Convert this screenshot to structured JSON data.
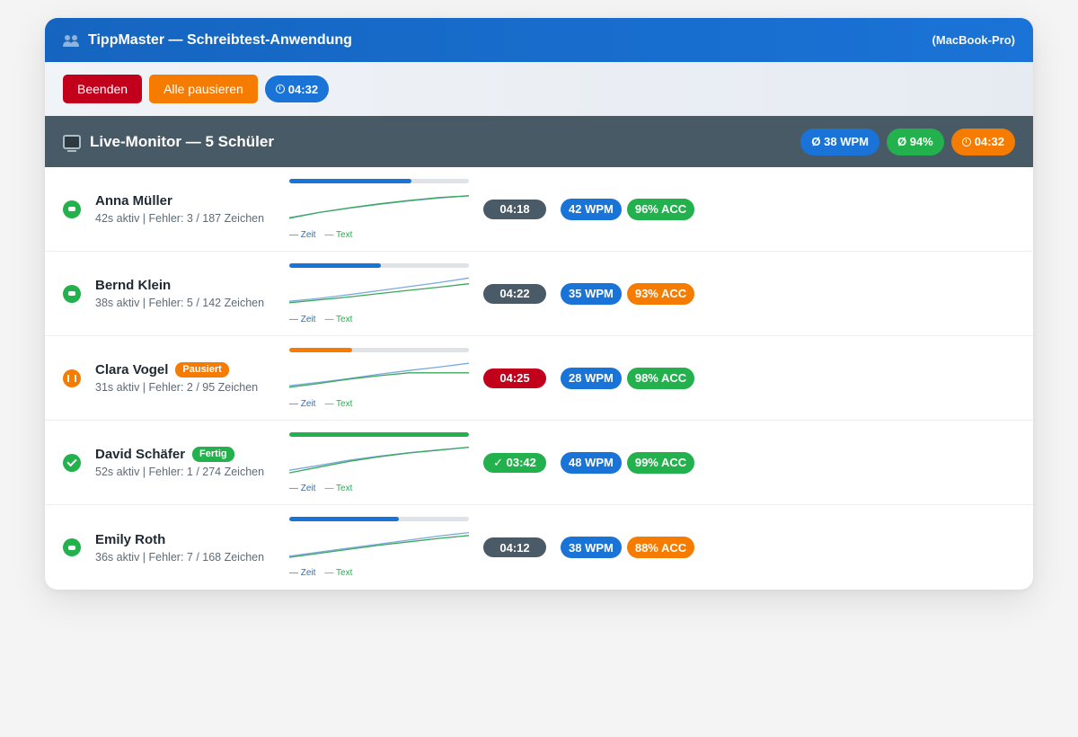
{
  "window": {
    "title": "TippMaster — Schreibtest-Anwendung",
    "device": "(MacBook-Pro)",
    "title_icon": "users-icon"
  },
  "toolbar": {
    "end_label": "Beenden",
    "pause_all_label": "Alle pausieren",
    "timer": "04:32"
  },
  "monitor": {
    "title": "Live-Monitor — 5 Schüler",
    "icon": "tv-icon",
    "avg_wpm": "Ø 38 WPM",
    "avg_acc": "Ø 94%",
    "timer": "04:32"
  },
  "legend": {
    "zeit": "— Zeit",
    "text": "— Text"
  },
  "colors": {
    "primary": "#1a73d6",
    "success": "#22b14c",
    "warning": "#f57c00",
    "danger": "#c2001b",
    "dark": "#4a5a66"
  },
  "students": [
    {
      "name": "Anna Müller",
      "badge": "",
      "status": "active",
      "meta": "42s aktiv | Fehler: 3 / 187 Zeichen",
      "progress": 0.68,
      "progress_color": "#1a73d6",
      "time": "04:18",
      "time_color": "dark",
      "wpm": "42 WPM",
      "acc": "96% ACC",
      "acc_color": "green",
      "zeit_series": [
        0.12,
        0.3,
        0.45,
        0.58,
        0.7,
        0.8,
        0.88
      ],
      "text_series": [
        0.1,
        0.3,
        0.46,
        0.6,
        0.72,
        0.82,
        0.88
      ]
    },
    {
      "name": "Bernd Klein",
      "badge": "",
      "status": "active",
      "meta": "38s aktiv | Fehler: 5 / 142 Zeichen",
      "progress": 0.51,
      "progress_color": "#1a73d6",
      "time": "04:22",
      "time_color": "dark",
      "wpm": "35 WPM",
      "acc": "93% ACC",
      "acc_color": "orange",
      "zeit_series": [
        0.15,
        0.25,
        0.38,
        0.52,
        0.66,
        0.8,
        0.96
      ],
      "text_series": [
        0.1,
        0.2,
        0.3,
        0.42,
        0.53,
        0.64,
        0.76
      ]
    },
    {
      "name": "Clara Vogel",
      "badge": "Pausiert",
      "status": "paused",
      "meta": "31s aktiv | Fehler: 2 / 95 Zeichen",
      "progress": 0.35,
      "progress_color": "#f57c00",
      "time": "04:25",
      "time_color": "red",
      "wpm": "28 WPM",
      "acc": "98% ACC",
      "acc_color": "green",
      "zeit_series": [
        0.15,
        0.27,
        0.4,
        0.55,
        0.68,
        0.8,
        0.93
      ],
      "text_series": [
        0.1,
        0.23,
        0.38,
        0.5,
        0.6,
        0.6,
        0.6
      ]
    },
    {
      "name": "David Schäfer",
      "badge": "Fertig",
      "status": "done",
      "meta": "52s aktiv | Fehler: 1 / 274 Zeichen",
      "progress": 1.0,
      "progress_color": "#22b14c",
      "time": "✓ 03:42",
      "time_color": "green",
      "wpm": "48 WPM",
      "acc": "99% ACC",
      "acc_color": "green",
      "zeit_series": [
        0.15,
        0.32,
        0.5,
        0.64,
        0.76,
        0.86,
        0.95
      ],
      "text_series": [
        0.06,
        0.26,
        0.46,
        0.62,
        0.75,
        0.85,
        0.95
      ]
    },
    {
      "name": "Emily Roth",
      "badge": "",
      "status": "active",
      "meta": "36s aktiv | Fehler: 7 / 168 Zeichen",
      "progress": 0.61,
      "progress_color": "#1a73d6",
      "time": "04:12",
      "time_color": "dark",
      "wpm": "38 WPM",
      "acc": "88% ACC",
      "acc_color": "orange",
      "zeit_series": [
        0.1,
        0.24,
        0.38,
        0.52,
        0.66,
        0.8,
        0.92
      ],
      "text_series": [
        0.06,
        0.2,
        0.34,
        0.48,
        0.6,
        0.72,
        0.82
      ]
    }
  ]
}
